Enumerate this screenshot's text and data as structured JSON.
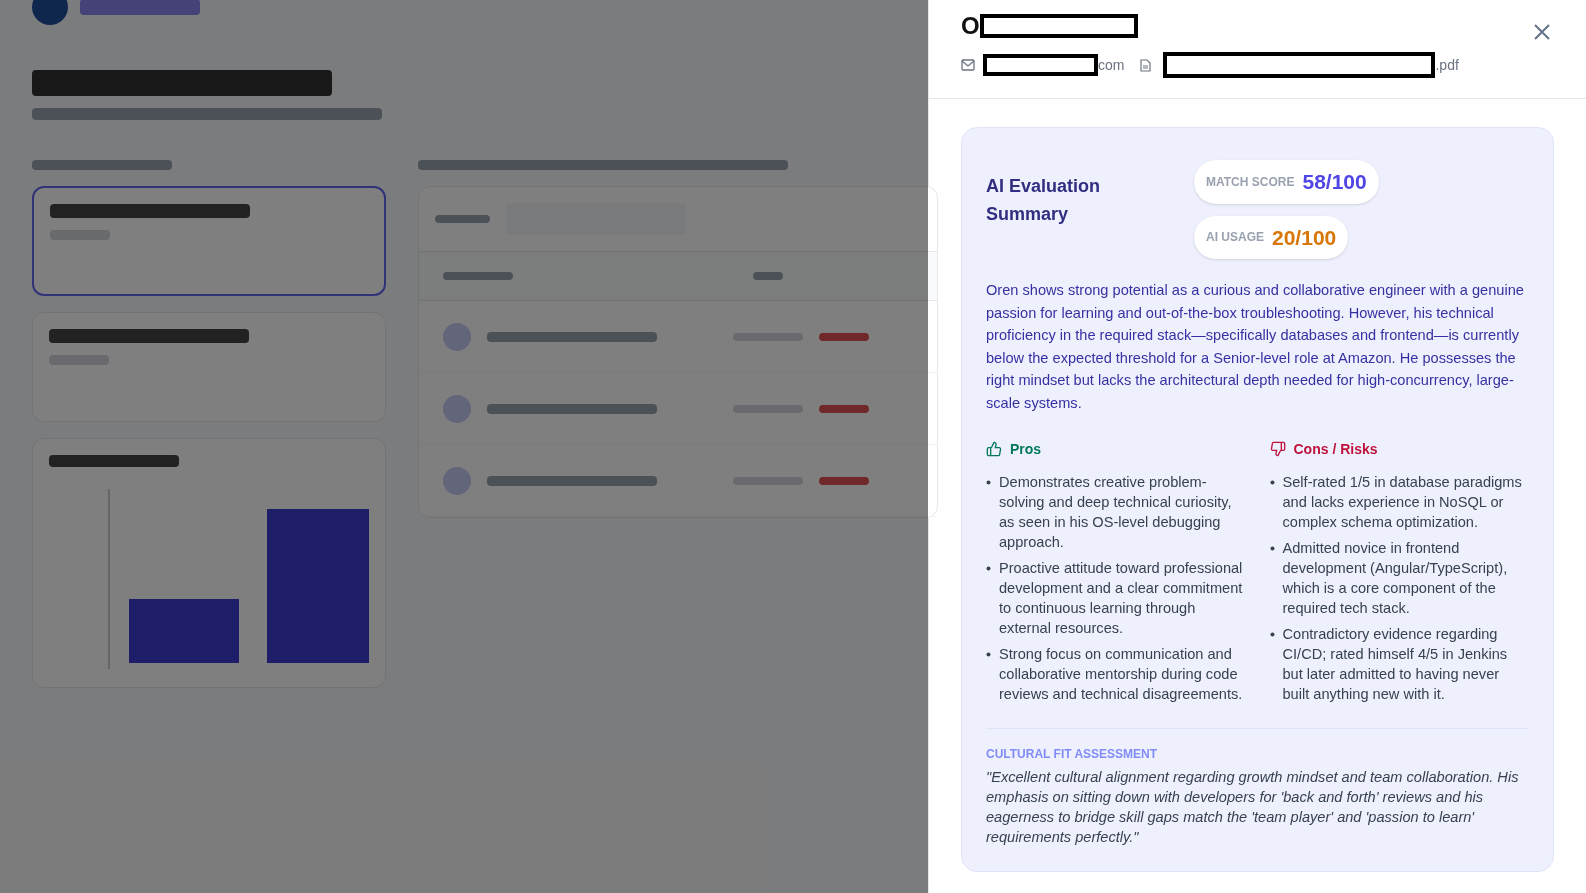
{
  "background": {
    "positions": [
      {
        "selected": true
      },
      {
        "selected": false
      }
    ]
  },
  "panel": {
    "name": "O",
    "email": "com",
    "file": ".pdf",
    "summary_title": "AI Evaluation Summary",
    "scores": [
      {
        "kind": "match",
        "label": "MATCH SCORE",
        "value": "58/100"
      },
      {
        "kind": "usage",
        "label": "AI USAGE",
        "value": "20/100"
      }
    ],
    "summary": "Oren shows strong potential as a curious and collaborative engineer with a genuine passion for learning and out-of-the-box troubleshooting. However, his technical proficiency in the required stack—specifically databases and frontend—is currently below the expected threshold for a Senior-level role at Amazon. He possesses the right mindset but lacks the architectural depth needed for high-concurrency, large-scale systems.",
    "pros_title": "Pros",
    "pros": [
      "Demonstrates creative problem-solving and deep technical curiosity, as seen in his OS-level debugging approach.",
      "Proactive attitude toward professional development and a clear commitment to continuous learning through external resources.",
      "Strong focus on communication and collaborative mentorship during code reviews and technical disagreements."
    ],
    "cons_title": "Cons / Risks",
    "cons": [
      "Self-rated 1/5 in database paradigms and lacks experience in NoSQL or complex schema optimization.",
      "Admitted novice in frontend development (Angular/TypeScript), which is a core component of the required tech stack.",
      "Contradictory evidence regarding CI/CD; rated himself 4/5 in Jenkins but later admitted to having never built anything new with it."
    ],
    "fit_heading": "CULTURAL FIT ASSESSMENT",
    "fit_text": "\"Excellent cultural alignment regarding growth mindset and team collaboration. His emphasis on sitting down with developers for 'back and forth' reviews and his eagerness to bridge skill gaps match the 'team player' and 'passion to learn' requirements perfectly.\""
  }
}
